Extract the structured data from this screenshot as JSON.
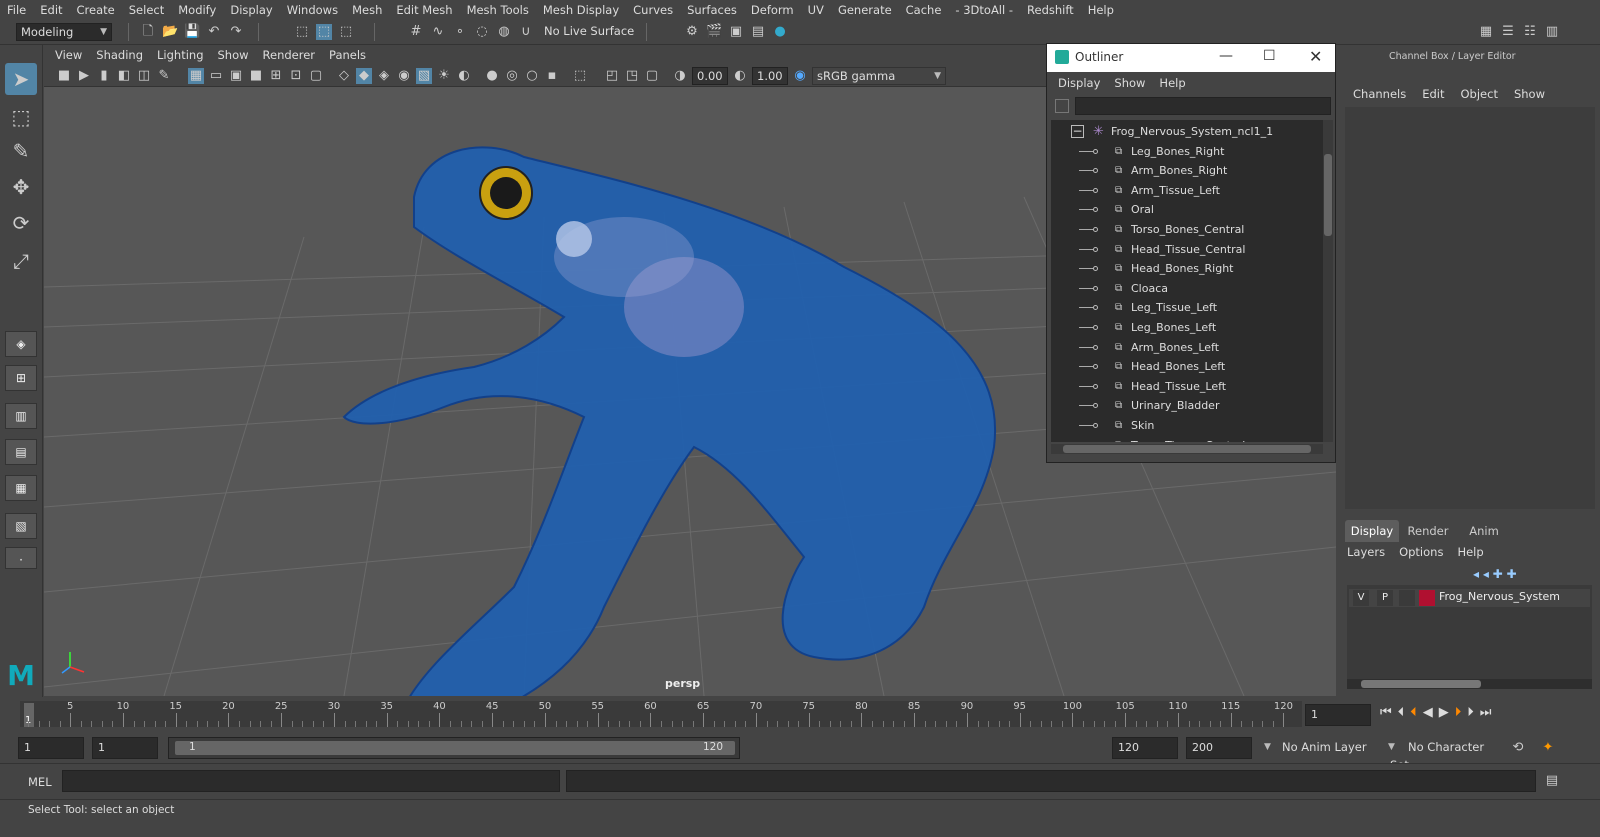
{
  "menubar": [
    "File",
    "Edit",
    "Create",
    "Select",
    "Modify",
    "Display",
    "Windows",
    "Mesh",
    "Edit Mesh",
    "Mesh Tools",
    "Mesh Display",
    "Curves",
    "Surfaces",
    "Deform",
    "UV",
    "Generate",
    "Cache",
    "- 3DtoAll -",
    "Redshift",
    "Help"
  ],
  "statusline": {
    "mode_selector": "Modeling",
    "live_surface": "No Live Surface"
  },
  "viewport": {
    "menu": [
      "View",
      "Shading",
      "Lighting",
      "Show",
      "Renderer",
      "Panels"
    ],
    "exposure": "0.00",
    "gamma": "1.00",
    "color_space": "sRGB gamma",
    "camera_label": "persp",
    "model_color": "#1f5fb0"
  },
  "outliner": {
    "title": "Outliner",
    "menu": [
      "Display",
      "Show",
      "Help"
    ],
    "root": "Frog_Nervous_System_ncl1_1",
    "items": [
      "Leg_Bones_Right",
      "Arm_Bones_Right",
      "Arm_Tissue_Left",
      "Oral",
      "Torso_Bones_Central",
      "Head_Tissue_Central",
      "Head_Bones_Right",
      "Cloaca",
      "Leg_Tissue_Left",
      "Leg_Bones_Left",
      "Arm_Bones_Left",
      "Head_Bones_Left",
      "Head_Tissue_Left",
      "Urinary_Bladder",
      "Skin",
      "Torso_Tissue_Central"
    ]
  },
  "channelbox": {
    "title": "Channel Box / Layer Editor",
    "menu": [
      "Channels",
      "Edit",
      "Object",
      "Show"
    ],
    "tabs": [
      "Display",
      "Render",
      "Anim"
    ],
    "layer_menu": [
      "Layers",
      "Options",
      "Help"
    ],
    "layer": {
      "v": "V",
      "p": "P",
      "name": "Frog_Nervous_System",
      "color": "#b01030"
    }
  },
  "timeline": {
    "ticks": [
      "5",
      "10",
      "15",
      "20",
      "25",
      "30",
      "35",
      "40",
      "45",
      "50",
      "55",
      "60",
      "65",
      "70",
      "75",
      "80",
      "85",
      "90",
      "95",
      "100",
      "105",
      "110",
      "115",
      "120"
    ],
    "current_frame_marker": "1",
    "current_frame": "1"
  },
  "range": {
    "start": "1",
    "playback_start": "1",
    "slider_start": "1",
    "slider_end": "120",
    "playback_end": "120",
    "end": "200",
    "anim_layer": "No Anim Layer",
    "character_set": "No Character Set"
  },
  "cmdline": {
    "label": "MEL"
  },
  "helpline": {
    "text": "Select Tool: select an object"
  }
}
